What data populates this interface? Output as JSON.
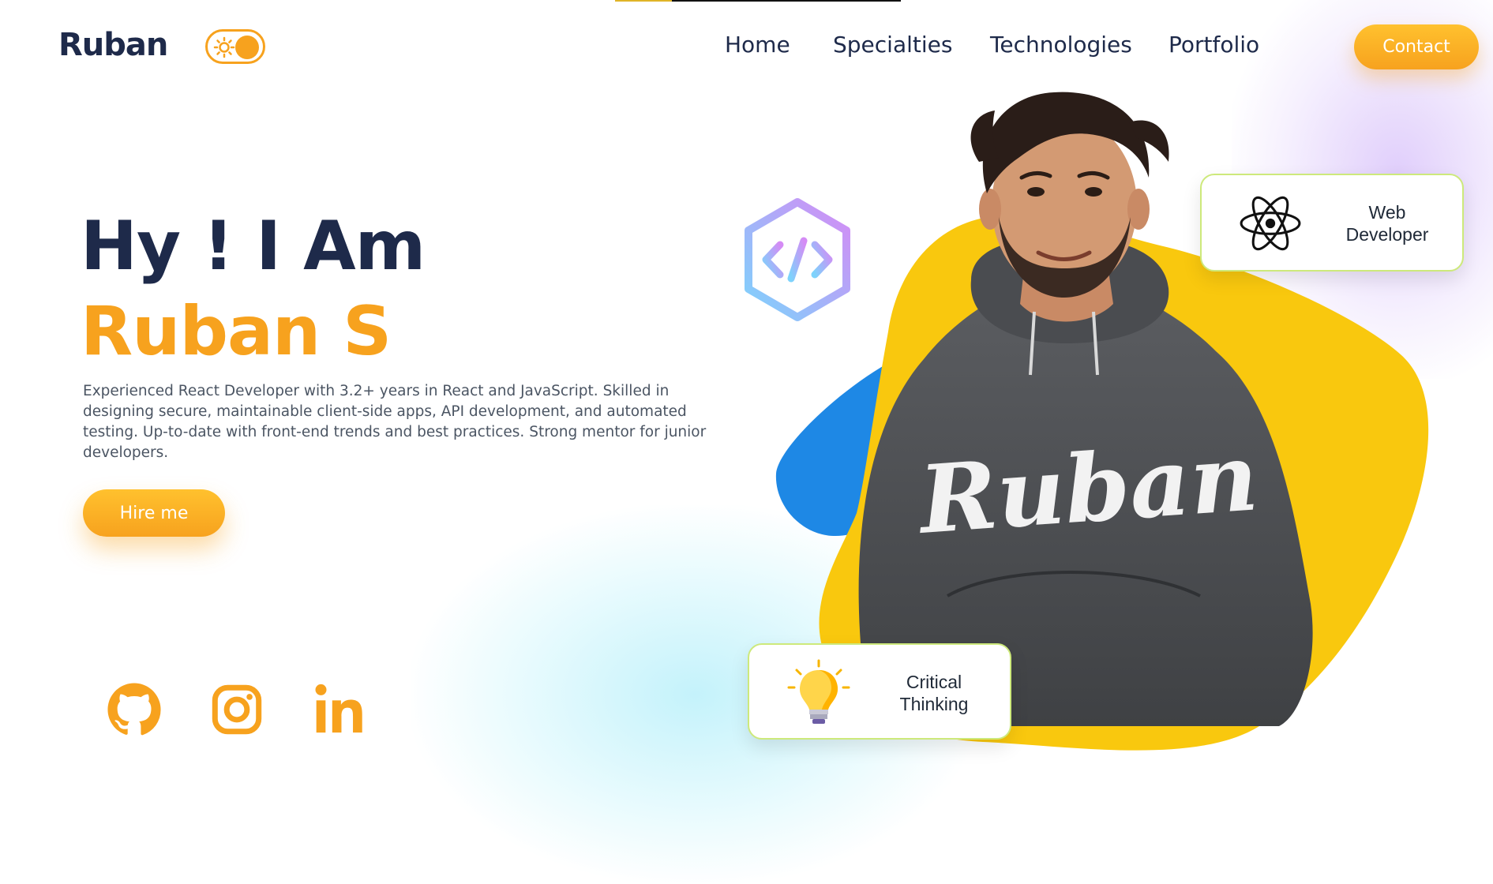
{
  "header": {
    "logo": "Ruban",
    "theme_toggle_icon": "sun-icon",
    "nav": [
      "Home",
      "Specialties",
      "Technologies",
      "Portfolio"
    ],
    "contact_label": "Contact"
  },
  "top_progress": {
    "fraction": 0.2
  },
  "hero": {
    "greeting": "Hy ! I Am",
    "name": "Ruban S",
    "description": "Experienced React Developer with 3.2+ years in React and JavaScript. Skilled in designing secure, maintainable client-side apps, API development, and automated testing. Up-to-date with front-end trends and best practices. Strong mentor for junior developers.",
    "hire_label": "Hire me"
  },
  "socials": [
    {
      "icon": "github-icon"
    },
    {
      "icon": "instagram-icon"
    },
    {
      "icon": "linkedin-icon"
    }
  ],
  "visual": {
    "hoodie_text": "Ruban",
    "code_badge_icon": "code-icon"
  },
  "cards": {
    "web": {
      "icon": "react-atom-icon",
      "line1": "Web",
      "line2": "Developer"
    },
    "thinking": {
      "icon": "lightbulb-icon",
      "line1": "Critical",
      "line2": "Thinking"
    }
  },
  "colors": {
    "accent": "#f7a21e",
    "navy": "#1e2a4a",
    "blob_yellow": "#f9c80e",
    "blob_blue": "#1e88e5"
  }
}
